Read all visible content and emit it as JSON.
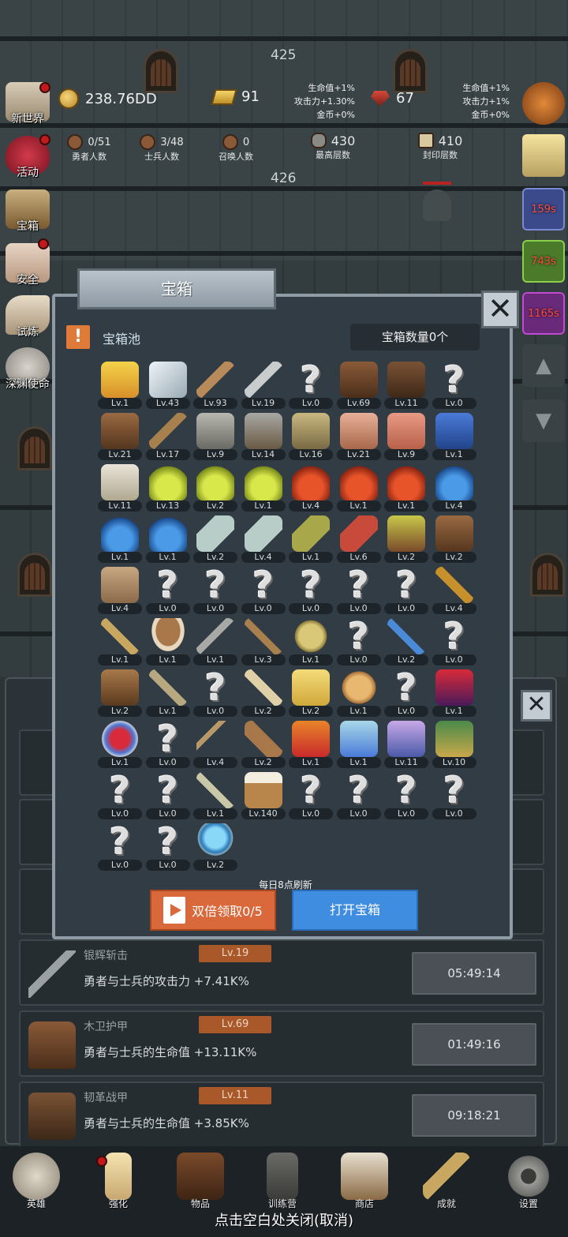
{
  "floors": {
    "f1": "425",
    "f2": "426"
  },
  "currency": {
    "gold": "238.76DD",
    "goldbar": "91",
    "gem": "67"
  },
  "bonus_left": [
    "生命值+1%",
    "攻击力+1.30%",
    "金币+0%"
  ],
  "bonus_right": [
    "生命值+1%",
    "攻击力+1%",
    "金币+0%"
  ],
  "stats": [
    {
      "value": "0/51",
      "label": "勇者人数"
    },
    {
      "value": "3/48",
      "label": "士兵人数"
    },
    {
      "value": "0",
      "label": "召唤人数"
    },
    {
      "value": "430",
      "label": "最高层数"
    },
    {
      "value": "410",
      "label": "封印层数"
    }
  ],
  "side_menu": [
    "新世界",
    "活动",
    "宝箱",
    "安全",
    "试炼",
    "深渊使命"
  ],
  "right_timers": [
    "159s",
    "743s",
    "1165s"
  ],
  "dialog": {
    "title": "宝箱",
    "pool_label": "宝箱池",
    "count_label": "宝箱数量0个",
    "refresh_note": "每日8点刷新",
    "double_btn": "双倍领取0/5",
    "open_btn": "打开宝箱"
  },
  "items": [
    {
      "icon": "crown-icon",
      "lv": "Lv.1"
    },
    {
      "icon": "diamond-icon",
      "lv": "Lv.43"
    },
    {
      "icon": "sword-icon",
      "lv": "Lv.93"
    },
    {
      "icon": "silver-sword-icon",
      "lv": "Lv.19"
    },
    {
      "icon": "unknown-icon",
      "lv": "Lv.0"
    },
    {
      "icon": "wood-armor-icon",
      "lv": "Lv.69"
    },
    {
      "icon": "leather-armor-icon",
      "lv": "Lv.11"
    },
    {
      "icon": "unknown-icon",
      "lv": "Lv.0"
    },
    {
      "icon": "leather-helmet-icon",
      "lv": "Lv.21"
    },
    {
      "icon": "wood-sword-icon",
      "lv": "Lv.17"
    },
    {
      "icon": "iron-helmet-icon",
      "lv": "Lv.9"
    },
    {
      "icon": "hammer-icon",
      "lv": "Lv.14"
    },
    {
      "icon": "knight-helmet-icon",
      "lv": "Lv.16"
    },
    {
      "icon": "ham-icon",
      "lv": "Lv.21"
    },
    {
      "icon": "steak-icon",
      "lv": "Lv.9"
    },
    {
      "icon": "pouch-icon",
      "lv": "Lv.1"
    },
    {
      "icon": "rice-icon",
      "lv": "Lv.11"
    },
    {
      "icon": "yellow-potion-icon",
      "lv": "Lv.13"
    },
    {
      "icon": "yellow-potion-icon",
      "lv": "Lv.2"
    },
    {
      "icon": "yellow-potion-icon",
      "lv": "Lv.1"
    },
    {
      "icon": "red-potion-icon",
      "lv": "Lv.4"
    },
    {
      "icon": "red-potion-icon",
      "lv": "Lv.1"
    },
    {
      "icon": "red-potion-icon",
      "lv": "Lv.1"
    },
    {
      "icon": "blue-potion-icon",
      "lv": "Lv.4"
    },
    {
      "icon": "blue-potion-icon",
      "lv": "Lv.1"
    },
    {
      "icon": "blue-potion-icon",
      "lv": "Lv.1"
    },
    {
      "icon": "grey-bottle-icon",
      "lv": "Lv.2"
    },
    {
      "icon": "grey-bottle-icon",
      "lv": "Lv.4"
    },
    {
      "icon": "olive-bottle-icon",
      "lv": "Lv.1"
    },
    {
      "icon": "red-bottle-icon",
      "lv": "Lv.6"
    },
    {
      "icon": "winged-boot-icon",
      "lv": "Lv.2"
    },
    {
      "icon": "boot-icon",
      "lv": "Lv.2"
    },
    {
      "icon": "shoe-icon",
      "lv": "Lv.4"
    },
    {
      "icon": "unknown-icon",
      "lv": "Lv.0"
    },
    {
      "icon": "unknown-icon",
      "lv": "Lv.0"
    },
    {
      "icon": "unknown-icon",
      "lv": "Lv.0"
    },
    {
      "icon": "unknown-icon",
      "lv": "Lv.0"
    },
    {
      "icon": "unknown-icon",
      "lv": "Lv.0"
    },
    {
      "icon": "unknown-icon",
      "lv": "Lv.0"
    },
    {
      "icon": "torch-icon",
      "lv": "Lv.4"
    },
    {
      "icon": "wand-icon",
      "lv": "Lv.1"
    },
    {
      "icon": "mushroom-icon",
      "lv": "Lv.1"
    },
    {
      "icon": "pickaxe-icon",
      "lv": "Lv.1"
    },
    {
      "icon": "staff-icon",
      "lv": "Lv.3"
    },
    {
      "icon": "nuts-icon",
      "lv": "Lv.1"
    },
    {
      "icon": "unknown-icon",
      "lv": "Lv.0"
    },
    {
      "icon": "blue-scepter-icon",
      "lv": "Lv.2"
    },
    {
      "icon": "unknown-icon",
      "lv": "Lv.0"
    },
    {
      "icon": "backpack-icon",
      "lv": "Lv.2"
    },
    {
      "icon": "shovel-icon",
      "lv": "Lv.1"
    },
    {
      "icon": "unknown-icon",
      "lv": "Lv.0"
    },
    {
      "icon": "club-icon",
      "lv": "Lv.2"
    },
    {
      "icon": "cheese-icon",
      "lv": "Lv.2"
    },
    {
      "icon": "pie-icon",
      "lv": "Lv.1"
    },
    {
      "icon": "unknown-icon",
      "lv": "Lv.0"
    },
    {
      "icon": "red-crystal-icon",
      "lv": "Lv.1"
    },
    {
      "icon": "red-orb-icon",
      "lv": "Lv.1"
    },
    {
      "icon": "unknown-icon",
      "lv": "Lv.0"
    },
    {
      "icon": "bow-icon",
      "lv": "Lv.4"
    },
    {
      "icon": "quiver-icon",
      "lv": "Lv.2"
    },
    {
      "icon": "fire-emblem-icon",
      "lv": "Lv.1"
    },
    {
      "icon": "ice-emblem-icon",
      "lv": "Lv.1"
    },
    {
      "icon": "vine-emblem-icon",
      "lv": "Lv.11"
    },
    {
      "icon": "rune-emblem-icon",
      "lv": "Lv.10"
    },
    {
      "icon": "unknown-icon",
      "lv": "Lv.0"
    },
    {
      "icon": "unknown-icon",
      "lv": "Lv.0"
    },
    {
      "icon": "green-wand-icon",
      "lv": "Lv.1"
    },
    {
      "icon": "beer-mug-icon",
      "lv": "Lv.140"
    },
    {
      "icon": "unknown-icon",
      "lv": "Lv.0"
    },
    {
      "icon": "unknown-icon",
      "lv": "Lv.0"
    },
    {
      "icon": "unknown-icon",
      "lv": "Lv.0"
    },
    {
      "icon": "unknown-icon",
      "lv": "Lv.0"
    },
    {
      "icon": "unknown-icon",
      "lv": "Lv.0"
    },
    {
      "icon": "unknown-icon",
      "lv": "Lv.0"
    },
    {
      "icon": "crystal-ball-icon",
      "lv": "Lv.2"
    }
  ],
  "rows": [
    {
      "name": "银辉斩击",
      "lv": "Lv.19",
      "desc": "勇者与士兵的攻击力 +7.41K%",
      "time": "05:49:14"
    },
    {
      "name": "木卫护甲",
      "lv": "Lv.69",
      "desc": "勇者与士兵的生命值 +13.11K%",
      "time": "01:49:16"
    },
    {
      "name": "韧革战甲",
      "lv": "Lv.11",
      "desc": "勇者与士兵的生命值 +3.85K%",
      "time": "09:18:21"
    }
  ],
  "nav": [
    "英雄",
    "强化",
    "物品",
    "训练营",
    "商店",
    "成就",
    "设置"
  ],
  "close_hint": "点击空白处关闭(取消)",
  "colors": {
    "accent_orange": "#d9683a",
    "accent_blue": "#3f8de0",
    "level_badge": "#a9582a",
    "timer_red": "#ff4a3a"
  }
}
